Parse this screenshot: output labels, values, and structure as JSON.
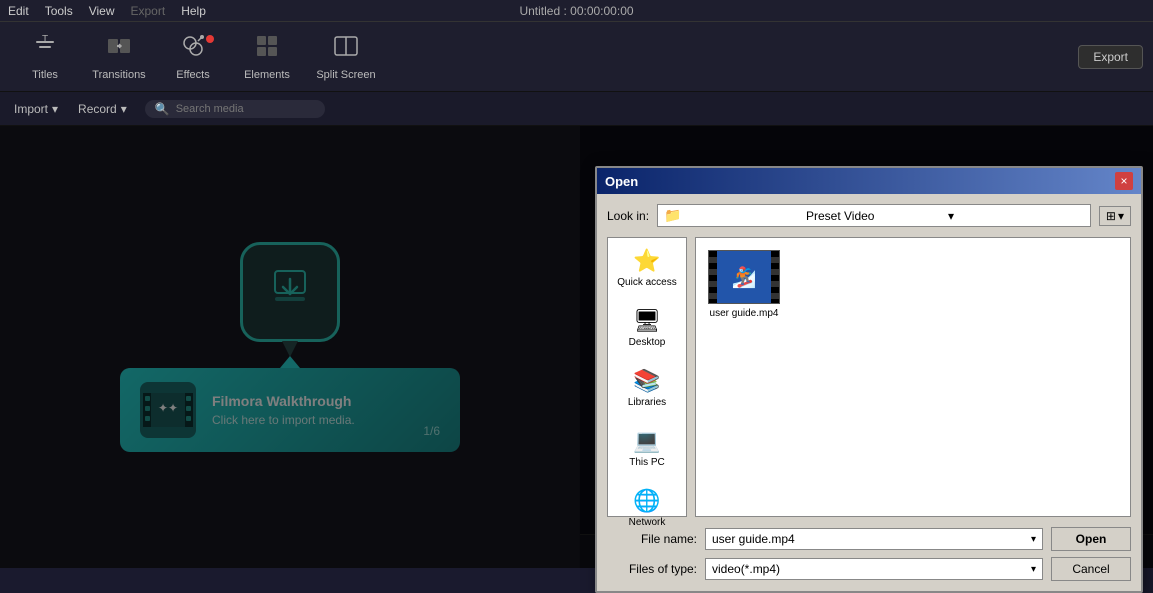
{
  "app": {
    "title": "Untitled : 00:00:00:00"
  },
  "menu": {
    "items": [
      "Edit",
      "Tools",
      "View",
      "Export",
      "Help"
    ]
  },
  "toolbar": {
    "items": [
      {
        "id": "titles",
        "label": "Titles",
        "icon": "T",
        "active": false
      },
      {
        "id": "transitions",
        "label": "Transitions",
        "icon": "⇄",
        "active": false
      },
      {
        "id": "effects",
        "label": "Effects",
        "icon": "✦",
        "active": false,
        "badge": true
      },
      {
        "id": "elements",
        "label": "Elements",
        "icon": "⬡",
        "active": false
      },
      {
        "id": "split-screen",
        "label": "Split Screen",
        "icon": "⊞",
        "active": false
      }
    ],
    "export_label": "Export"
  },
  "secondary_toolbar": {
    "import_label": "Import",
    "record_label": "Record",
    "search_placeholder": "Search media"
  },
  "walkthrough": {
    "title": "Filmora Walkthrough",
    "subtitle": "Click here to import media.",
    "count": "1/6"
  },
  "dialog": {
    "title": "Open",
    "close_label": "×",
    "look_in_label": "Look in:",
    "look_in_value": "Preset Video",
    "places": [
      {
        "id": "quick-access",
        "label": "Quick access",
        "icon": "⭐"
      },
      {
        "id": "desktop",
        "label": "Desktop",
        "icon": "🖥"
      },
      {
        "id": "libraries",
        "label": "Libraries",
        "icon": "📚"
      },
      {
        "id": "this-pc",
        "label": "This PC",
        "icon": "💻"
      },
      {
        "id": "network",
        "label": "Network",
        "icon": "🌐"
      }
    ],
    "files": [
      {
        "id": "user-guide",
        "name": "user guide.mp4",
        "type": "video"
      }
    ],
    "file_name_label": "File name:",
    "file_name_value": "user guide.mp4",
    "file_type_label": "Files of type:",
    "file_type_value": "video(*.mp4)",
    "open_label": "Open",
    "cancel_label": "Cancel"
  },
  "preview_controls": {
    "rewind_icon": "⏮",
    "back_icon": "◀",
    "play_icon": "▶",
    "stop_icon": "⏹"
  }
}
